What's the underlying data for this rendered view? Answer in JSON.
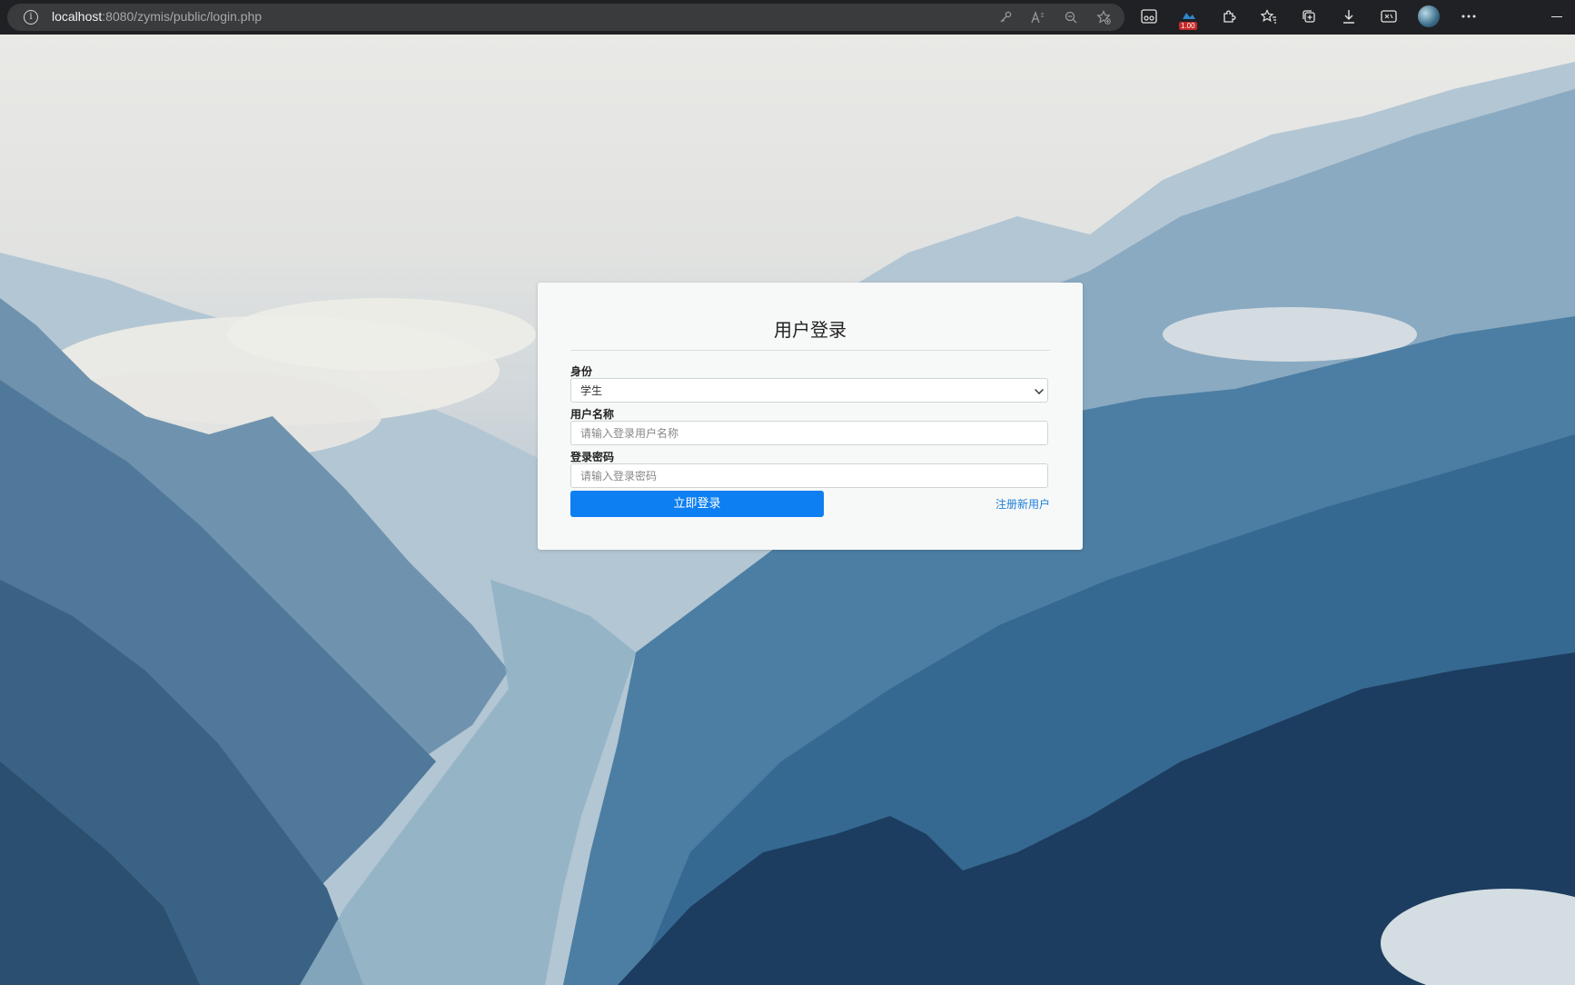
{
  "browser": {
    "url_host": "localhost",
    "url_rest": ":8080/zymis/public/login.php",
    "extension_badge": "1.00",
    "address_icons": [
      "key-icon",
      "read-aloud-icon",
      "zoom-out-icon",
      "favorite-add-icon"
    ],
    "toolbar_icons": [
      "immersive-reader-icon",
      "extension-badge-icon",
      "extensions-icon",
      "favorites-icon",
      "collections-icon",
      "downloads-icon",
      "screenshot-icon",
      "profile-avatar",
      "more-icon"
    ]
  },
  "login": {
    "title": "用户登录",
    "identity_label": "身份",
    "identity_value": "学生",
    "username_label": "用户名称",
    "username_placeholder": "请输入登录用户名称",
    "password_label": "登录密码",
    "password_placeholder": "请输入登录密码",
    "submit_label": "立即登录",
    "register_label": "注册新用户"
  },
  "colors": {
    "primary_button": "#0d7ff2",
    "link": "#1d7fd6",
    "browser_chrome": "#202124"
  }
}
